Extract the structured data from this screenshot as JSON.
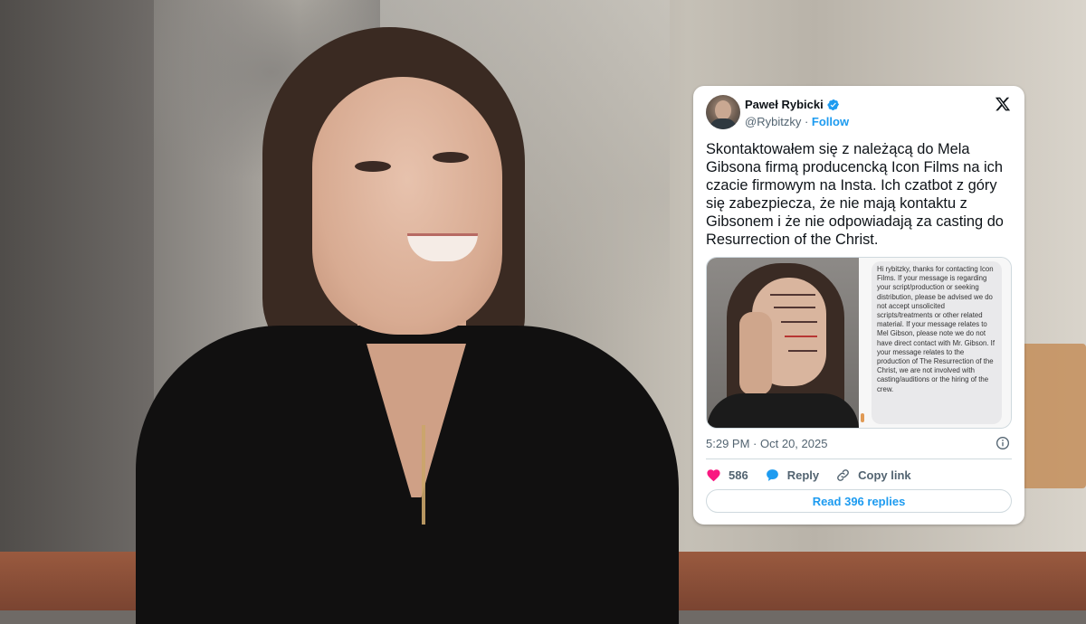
{
  "tweet": {
    "author_name": "Paweł Rybicki",
    "handle": "@Rybitzky",
    "separator": "·",
    "follow_label": "Follow",
    "text": "Skontaktowałem się z należącą do Mela Gibsona firmą producencką Icon Films na ich czacie firmowym na Insta. Ich czatbot z góry się zabezpiecza, że nie mają kontaktu z Gibsonem i że nie odpowiadają za casting do Resurrection of the Christ.",
    "media": {
      "chat_message": "Hi rybitzky, thanks for contacting Icon Films. If your message is regarding your script/production or seeking distribution, please be advised we do not accept unsolicited scripts/treatments or other related material. If your message relates to Mel Gibson, please note we do not have direct contact with Mr. Gibson. If your message relates to the production of The Resurrection of the Christ, we are not involved with casting/auditions or the hiring of the crew."
    },
    "time": "5:29 PM",
    "date": "Oct 20, 2025",
    "likes": "586",
    "reply_label": "Reply",
    "copy_link_label": "Copy link",
    "read_replies_label": "Read 396 replies"
  },
  "icons": {
    "verified": "verified-badge-icon",
    "platform": "x-logo-icon",
    "info": "info-icon",
    "like": "heart-icon",
    "reply": "speech-bubble-icon",
    "copy": "link-icon"
  },
  "colors": {
    "accent": "#1d9bf0",
    "like": "#f91880",
    "text": "#0f1419",
    "muted": "#536471"
  }
}
